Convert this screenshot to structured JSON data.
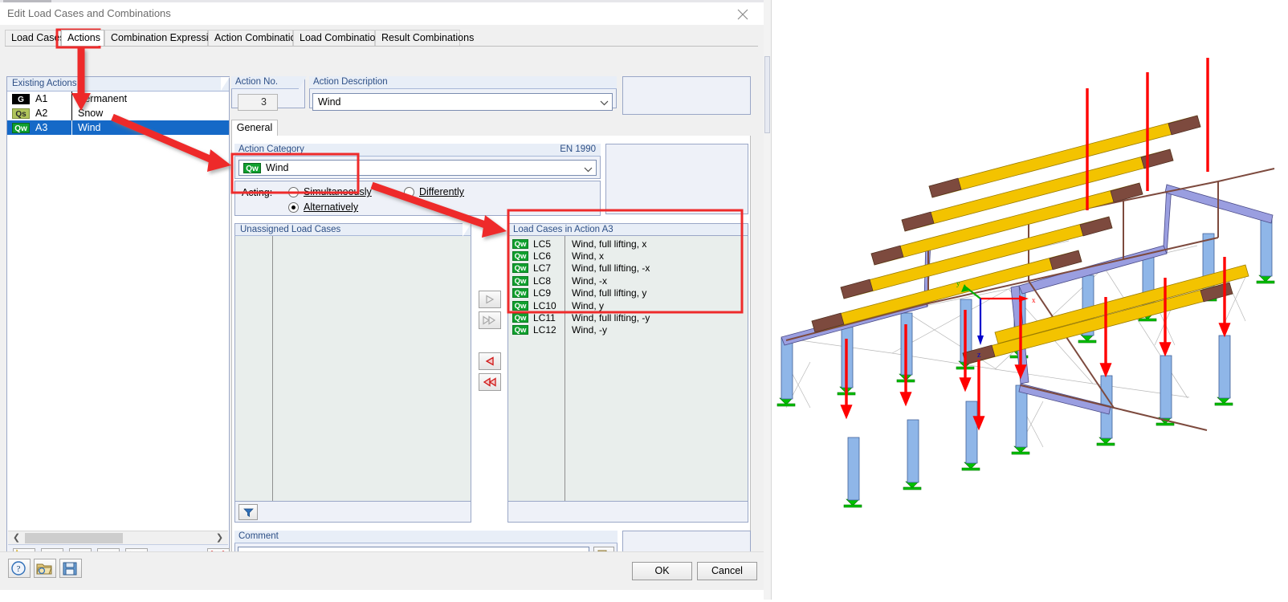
{
  "window": {
    "title": "Edit Load Cases and Combinations",
    "close_icon": "close-icon"
  },
  "tabs": [
    {
      "label": "Load Cases",
      "selected": false
    },
    {
      "label": "Actions",
      "selected": true
    },
    {
      "label": "Combination Expressions",
      "selected": false
    },
    {
      "label": "Action Combinations",
      "selected": false
    },
    {
      "label": "Load Combinations",
      "selected": false
    },
    {
      "label": "Result Combinations",
      "selected": false
    }
  ],
  "existing_actions": {
    "header": "Existing Actions",
    "rows": [
      {
        "badge": "G",
        "badge_class": "g",
        "no": "A1",
        "desc": "Permanent",
        "selected": false
      },
      {
        "badge": "Qs",
        "badge_class": "qs",
        "no": "A2",
        "desc": "Snow",
        "selected": false
      },
      {
        "badge": "Qw",
        "badge_class": "qw",
        "no": "A3",
        "desc": "Wind",
        "selected": true
      }
    ],
    "toolbar": [
      {
        "name": "new-action-button",
        "icon": "new-window-icon"
      },
      {
        "name": "rename-action-button",
        "icon": "rename-ab-icon"
      },
      {
        "name": "select-all-button",
        "icon": "checkbox-check-icon"
      },
      {
        "name": "deselect-all-button",
        "icon": "checkbox-clear-icon"
      },
      {
        "name": "renumber-button",
        "icon": "renumber-list-icon"
      },
      {
        "name": "delete-action-button",
        "icon": "red-x-icon"
      }
    ],
    "scroll_left_icon": "chevron-left-icon",
    "scroll_right_icon": "chevron-right-icon"
  },
  "action_no": {
    "label": "Action No.",
    "label_accel": "N",
    "value": "3"
  },
  "action_description": {
    "label": "Action Description",
    "label_accel": "D",
    "value": "Wind",
    "dropdown_icon": "chevron-down-icon"
  },
  "sub_tab": {
    "label": "General"
  },
  "action_category": {
    "label": "Action Category",
    "label_accel": "C",
    "standard": "EN 1990",
    "badge": "Qw",
    "value": "Wind",
    "dropdown_icon": "chevron-down-icon"
  },
  "acting": {
    "label": "Acting:",
    "options": [
      {
        "label": "Simultaneously",
        "accel": "S",
        "checked": false
      },
      {
        "label": "Alternatively",
        "accel": "A",
        "checked": true
      },
      {
        "label": "Differently",
        "accel": "D",
        "checked": false
      }
    ]
  },
  "unassigned": {
    "header": "Unassigned Load Cases",
    "rows": [],
    "filter_icon": "funnel-filter-icon"
  },
  "assigned": {
    "header": "Load Cases in Action A3",
    "rows": [
      {
        "badge": "Qw",
        "id": "LC5",
        "desc": "Wind, full lifting, x"
      },
      {
        "badge": "Qw",
        "id": "LC6",
        "desc": "Wind, x"
      },
      {
        "badge": "Qw",
        "id": "LC7",
        "desc": "Wind, full lifting, -x"
      },
      {
        "badge": "Qw",
        "id": "LC8",
        "desc": "Wind, -x"
      },
      {
        "badge": "Qw",
        "id": "LC9",
        "desc": "Wind, full lifting, y"
      },
      {
        "badge": "Qw",
        "id": "LC10",
        "desc": "Wind, y"
      },
      {
        "badge": "Qw",
        "id": "LC11",
        "desc": "Wind, full lifting, -y"
      },
      {
        "badge": "Qw",
        "id": "LC12",
        "desc": "Wind, -y"
      }
    ]
  },
  "transfer_buttons": [
    {
      "name": "assign-one-button",
      "icon": "arrow-right-icon",
      "enabled": false
    },
    {
      "name": "assign-all-button",
      "icon": "arrow-double-right-icon",
      "enabled": false
    },
    {
      "name": "unassign-one-button",
      "icon": "arrow-left-icon",
      "enabled": true
    },
    {
      "name": "unassign-all-button",
      "icon": "arrow-double-left-icon",
      "enabled": true
    }
  ],
  "comment": {
    "label": "Comment",
    "label_accel": "C",
    "value": "",
    "dropdown_icon": "chevron-down-icon",
    "picker_icon": "copy-windows-icon"
  },
  "footer": {
    "help_icon": "question-mark-icon",
    "open_icon": "open-folder-icon",
    "save_icon": "floppy-save-icon",
    "ok_label": "OK",
    "cancel_label": "Cancel"
  },
  "viewport": {
    "model": "3d-steel-frame-hall",
    "axes": {
      "x": "x",
      "y": "y",
      "z": "z"
    },
    "colors": {
      "column": "#8fb6e8",
      "rafter": "#9a9ee0",
      "purlin": "#f3c300",
      "haunch": "#7d4a3e",
      "load_arrow": "#ff0000",
      "support": "#00c000",
      "axis_x": "#ff0000",
      "axis_y": "#00b000",
      "axis_z": "#0000cc"
    }
  },
  "annotations": {
    "accent": "#ee2b2b",
    "highlight_boxes": [
      "actions-tab",
      "acting-group",
      "load-cases-in-action-list"
    ],
    "arrows": 3
  }
}
